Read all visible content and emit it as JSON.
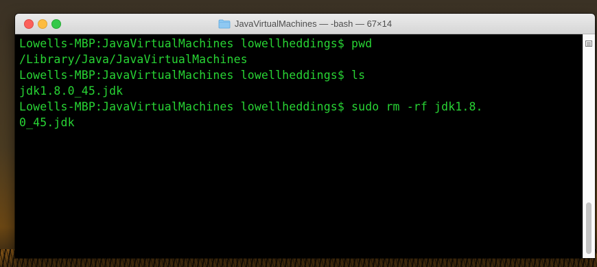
{
  "window": {
    "title": "JavaVirtualMachines — -bash — 67×14",
    "title_icon": "folder-icon"
  },
  "traffic_lights": {
    "close": "#fc605b",
    "minimize": "#fdbc40",
    "maximize": "#34c84a"
  },
  "terminal": {
    "text_color": "#28d434",
    "background": "#000000",
    "lines": [
      "Lowells-MBP:JavaVirtualMachines lowellheddings$ pwd",
      "/Library/Java/JavaVirtualMachines",
      "Lowells-MBP:JavaVirtualMachines lowellheddings$ ls",
      "jdk1.8.0_45.jdk",
      "Lowells-MBP:JavaVirtualMachines lowellheddings$ sudo rm -rf jdk1.8.",
      "0_45.jdk"
    ]
  },
  "scrollbar": {
    "menu_icon": "menu-icon"
  }
}
